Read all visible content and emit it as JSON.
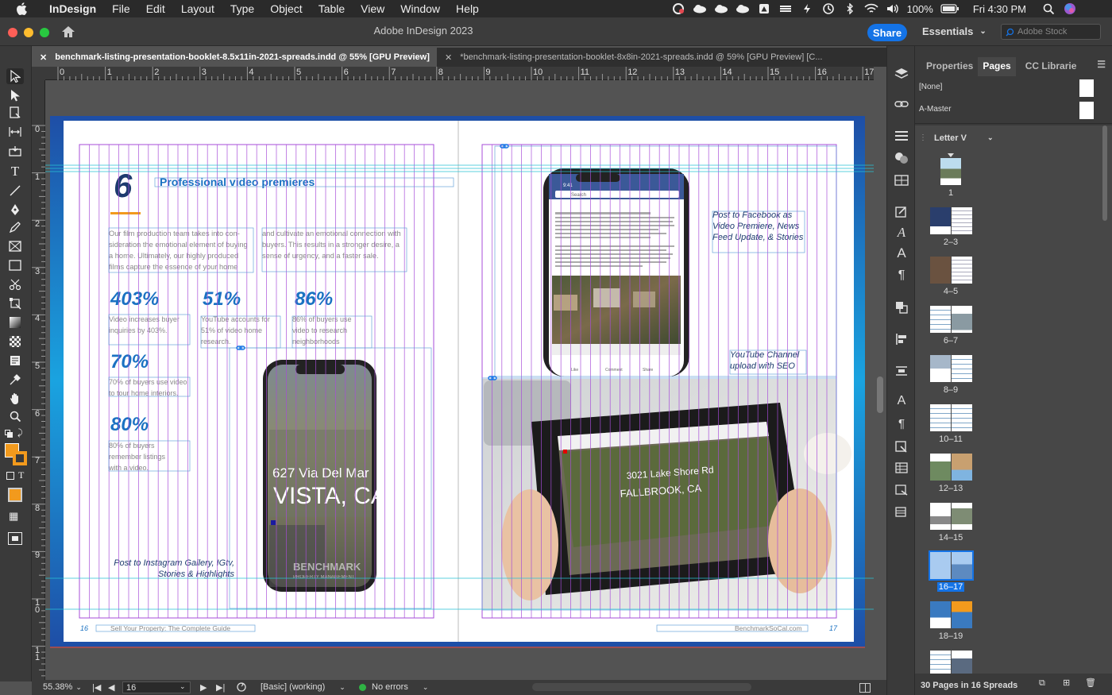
{
  "menubar": {
    "app_name": "InDesign",
    "items": [
      "File",
      "Edit",
      "Layout",
      "Type",
      "Object",
      "Table",
      "View",
      "Window",
      "Help"
    ],
    "battery": "100%",
    "clock": "Fri 4:30 PM"
  },
  "titlebar": {
    "title": "Adobe InDesign 2023",
    "share_label": "Share",
    "workspace": "Essentials",
    "stock_placeholder": "Adobe Stock"
  },
  "tabs": [
    {
      "label": "benchmark-listing-presentation-booklet-8.5x11in-2021-spreads.indd @ 55% [GPU Preview]",
      "close": "✕"
    },
    {
      "label": "*benchmark-listing-presentation-booklet-8x8in-2021-spreads.indd @ 59% [GPU Preview] [C...",
      "close": "✕"
    }
  ],
  "rulers": {
    "h_ticks": [
      "0",
      "1",
      "2",
      "3",
      "4",
      "5",
      "6",
      "7",
      "8",
      "9",
      "10",
      "11",
      "12",
      "13",
      "14",
      "15",
      "16",
      "17"
    ],
    "v_ticks": [
      "0",
      "1",
      "2",
      "3",
      "4",
      "5",
      "6",
      "7",
      "8",
      "9",
      "1\n0",
      "1\n1"
    ]
  },
  "page_left": {
    "number_big": "6",
    "heading": "Professional video premieres",
    "body_col1": "Our film production team takes into con-sideration the emotional element of buying a home. Ultimately, our highly produced films capture the essence of your home",
    "body_col2": "and cultivate an emotional connection with buyers. This results in a stronger desire, a sense of urgency, and a faster sale.",
    "stats": [
      {
        "value": "403%",
        "text": "Video increases buyer inquiries by 403%."
      },
      {
        "value": "51%",
        "text": "YouTube accounts for 51% of video home research."
      },
      {
        "value": "86%",
        "text": "86% of buyers use video to research neighborhoods"
      },
      {
        "value": "70%",
        "text": "70% of buyers use video to tour home interiors."
      },
      {
        "value": "80%",
        "text": "80% of buyers remember listings with a video."
      }
    ],
    "phone_overlay_line1": "627 Via Del Mar",
    "phone_overlay_line2": "VISTA, CA",
    "phone_watermark": "BENCHMARK",
    "phone_watermark_sub": "PROPERTY MANAGEMENT",
    "instagram_caption": "Post to Instagram Gallery, IGtv, Stories & Highlights",
    "folio": "16",
    "footer": "Sell Your Property: The Complete Guide"
  },
  "page_right": {
    "facebook_caption": "Post to Facebook as Video Premiere, News Feed Update, & Stories",
    "youtube_caption": "YouTube Channel upload with SEO",
    "fb_time": "9:41",
    "fb_search": "Search",
    "fb_actions": [
      "Like",
      "Comment",
      "Share"
    ],
    "tablet_overlay_line1": "3021 Lake Shore Rd",
    "tablet_overlay_line2": "FALLBROOK, CA",
    "folio": "17",
    "footer": "BenchmarkSoCal.com"
  },
  "statusbar": {
    "zoom": "55.38%",
    "page": "16",
    "style": "[Basic] (working)",
    "preflight": "No errors"
  },
  "panel": {
    "tabs": [
      "Properties",
      "Pages",
      "CC Librarie"
    ],
    "masters": [
      "[None]",
      "A-Master"
    ],
    "size_label": "Letter V",
    "pages": [
      "1",
      "2–3",
      "4–5",
      "6–7",
      "8–9",
      "10–11",
      "12–13",
      "14–15",
      "16–17",
      "18–19"
    ],
    "selected_page": "16–17",
    "footer": "30 Pages in 16 Spreads"
  },
  "colors": {
    "accent_blue": "#1473e6",
    "brand_blue": "#1d6fb8",
    "heading_blue": "#1a72c2",
    "orange": "#f29a1d",
    "guide_purple": "#a74cd9",
    "guide_cyan": "#29c3d4"
  }
}
